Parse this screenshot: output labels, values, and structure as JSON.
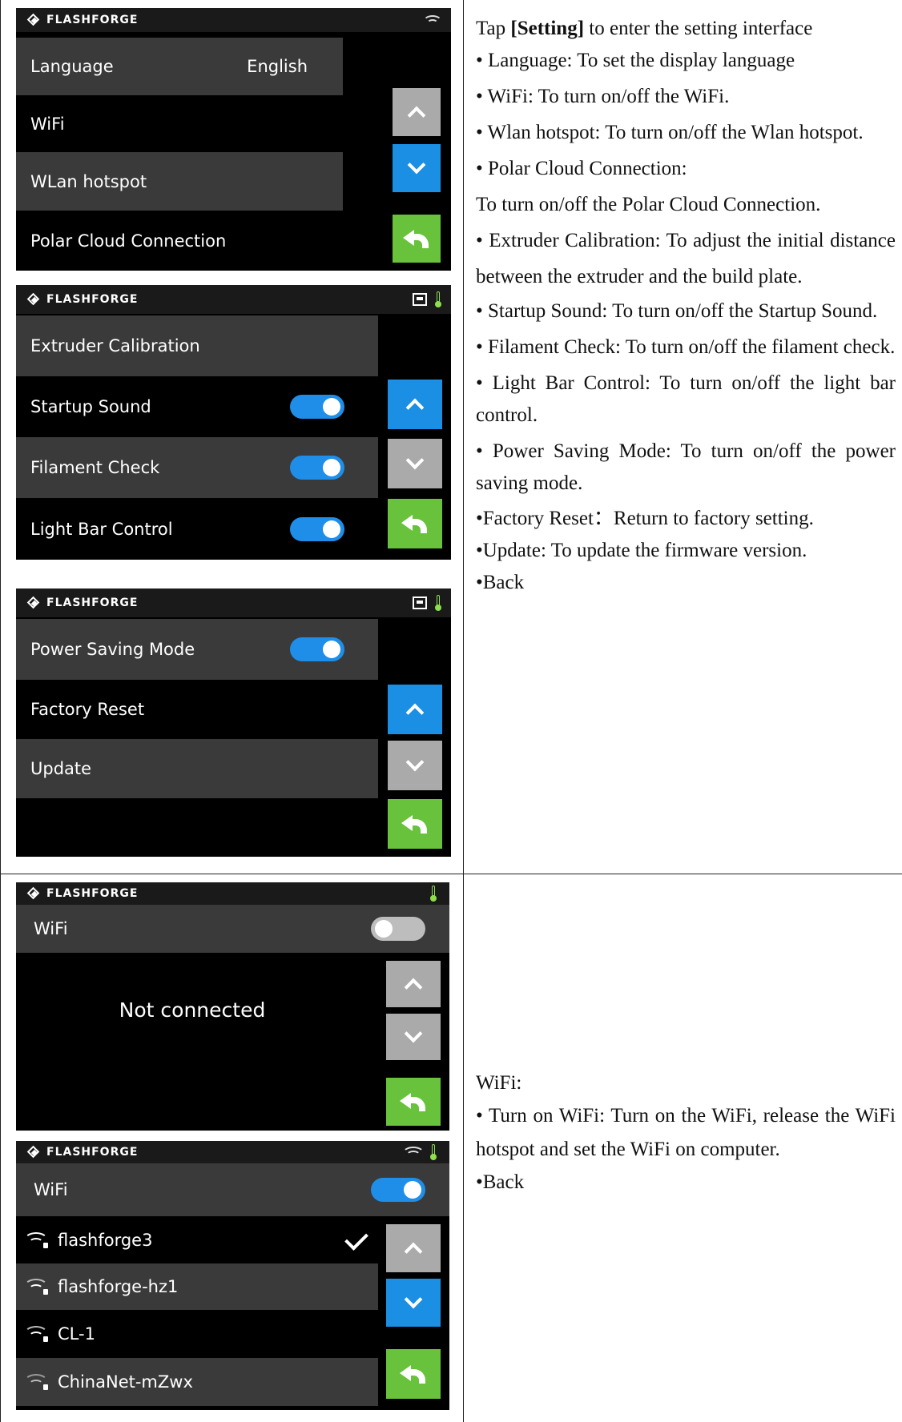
{
  "screens": {
    "settings1": {
      "brand": "FLASHFORGE",
      "language_label": "Language",
      "language_value": "English",
      "wifi_label": "WiFi",
      "hotspot_label": "WLan hotspot",
      "polar_label": "Polar Cloud Connection"
    },
    "settings2": {
      "brand": "FLASHFORGE",
      "extruder_label": "Extruder Calibration",
      "startup_label": "Startup Sound",
      "filament_label": "Filament Check",
      "lightbar_label": "Light Bar Control",
      "startup_on": true,
      "filament_on": true,
      "lightbar_on": true
    },
    "settings3": {
      "brand": "FLASHFORGE",
      "power_label": "Power Saving Mode",
      "factory_label": "Factory Reset",
      "update_label": "Update",
      "power_on": true
    },
    "wifi_off": {
      "brand": "FLASHFORGE",
      "title": "WiFi",
      "status": "Not connected",
      "wifi_on": false
    },
    "wifi_on": {
      "brand": "FLASHFORGE",
      "title": "WiFi",
      "wifi_on": true,
      "networks": [
        {
          "name": "flashforge3",
          "connected": true
        },
        {
          "name": "flashforge-hz1",
          "connected": false
        },
        {
          "name": "CL-1",
          "connected": false
        },
        {
          "name": "ChinaNet-mZwx",
          "connected": false
        }
      ]
    }
  },
  "text1": {
    "intro_pre": "Tap ",
    "intro_bold": "[Setting]",
    "intro_post": " to enter the setting interface",
    "items": [
      "• Language: To set the display language",
      "• WiFi: To turn on/off the WiFi.",
      "• Wlan hotspot: To turn on/off the Wlan hotspot.",
      "• Polar Cloud Connection:",
      "To turn on/off the Polar Cloud Connection.",
      "• Extruder Calibration: To adjust the initial distance between the extruder and the build plate.",
      "• Startup Sound: To turn on/off the Startup Sound.",
      "• Filament Check: To turn on/off the filament check.",
      "• Light Bar Control: To turn on/off the light bar control.",
      "• Power Saving Mode: To turn on/off the power saving mode.",
      "•Factory Reset：Return to factory setting.",
      "•Update: To update the firmware version.",
      "•Back"
    ]
  },
  "text2": {
    "items": [
      "WiFi:",
      "• Turn on WiFi: Turn on the WiFi, release the WiFi hotspot and set the WiFi on computer.",
      "•Back"
    ]
  }
}
